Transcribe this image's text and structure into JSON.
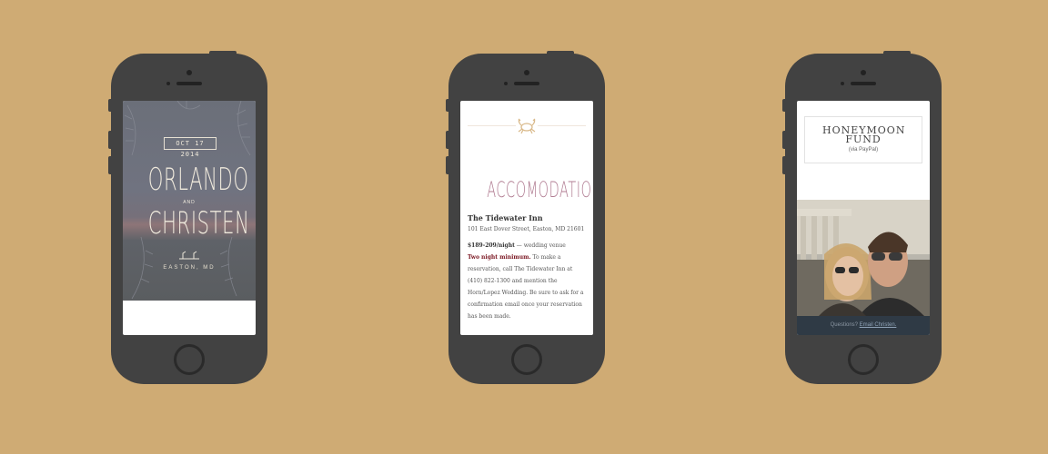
{
  "phones": [
    {
      "date": "OCT 17 2014",
      "name1": "ORLANDO",
      "and": "AND",
      "name2": "CHRISTEN",
      "location": "EASTON, MD"
    },
    {
      "icon": "crab-icon",
      "title": "ACCOMODATIONS",
      "inn_name": "The Tidewater Inn",
      "address": "101 East Dover Street, Easton, MD 21601",
      "rate": "$189-209/night",
      "rate_note": " — wedding venue",
      "minimum": "Two night minimum.",
      "details": " To make a reservation, call The Tidewater Inn at (410) 822-1300 and mention the Horn/Lopez Wedding. Be sure to ask for a confirmation email once your reservation has been made."
    },
    {
      "title": "HONEYMOON FUND",
      "subtitle": "(via PayPal)",
      "footer_text": "Questions? ",
      "footer_link": "Email Christen."
    }
  ],
  "colors": {
    "background": "#cfab74",
    "phone_body": "#424242",
    "accent_pink": "#b07b91",
    "accent_red": "#7a1520"
  }
}
